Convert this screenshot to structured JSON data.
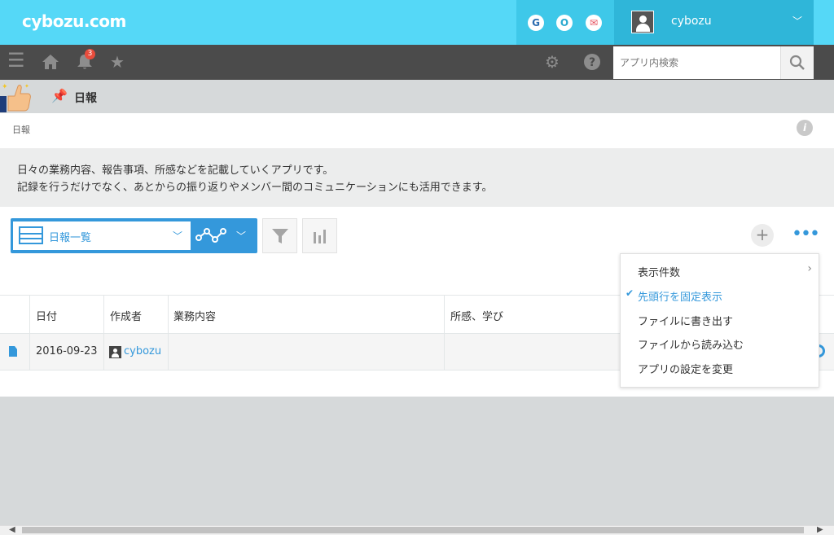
{
  "header": {
    "logo": "cybozu.com",
    "services": [
      {
        "name": "garoon",
        "glyph": "G",
        "color": "#2b6cb0"
      },
      {
        "name": "office",
        "glyph": "O",
        "color": "#2aa9cf"
      },
      {
        "name": "mailwise",
        "glyph": "✉",
        "color": "#e5505e"
      }
    ],
    "user_name": "cybozu"
  },
  "gnav": {
    "notification_count": "3",
    "search_placeholder": "アプリ内検索"
  },
  "app": {
    "title": "日報",
    "breadcrumb": "日報",
    "description_line1": "日々の業務内容、報告事項、所感などを記載していくアプリです。",
    "description_line2": "記録を行うだけでなく、あとからの振り返りやメンバー間のコミュニケーションにも活用できます。"
  },
  "view": {
    "selected": "日報一覧"
  },
  "table": {
    "headers": [
      "日付",
      "作成者",
      "業務内容",
      "所感、学び"
    ],
    "rows": [
      {
        "date": "2016-09-23",
        "creator": "cybozu",
        "work": "",
        "notes": ""
      }
    ]
  },
  "menu": {
    "items": [
      {
        "label": "表示件数",
        "checked": false,
        "submenu": true
      },
      {
        "label": "先頭行を固定表示",
        "checked": true,
        "submenu": false
      },
      {
        "label": "ファイルに書き出す",
        "checked": false,
        "submenu": false
      },
      {
        "label": "ファイルから読み込む",
        "checked": false,
        "submenu": false
      },
      {
        "label": "アプリの設定を変更",
        "checked": false,
        "submenu": false
      }
    ]
  },
  "colors": {
    "topbar": "#55d8f7",
    "gnav": "#4b4b4b",
    "accent": "#3498db"
  }
}
